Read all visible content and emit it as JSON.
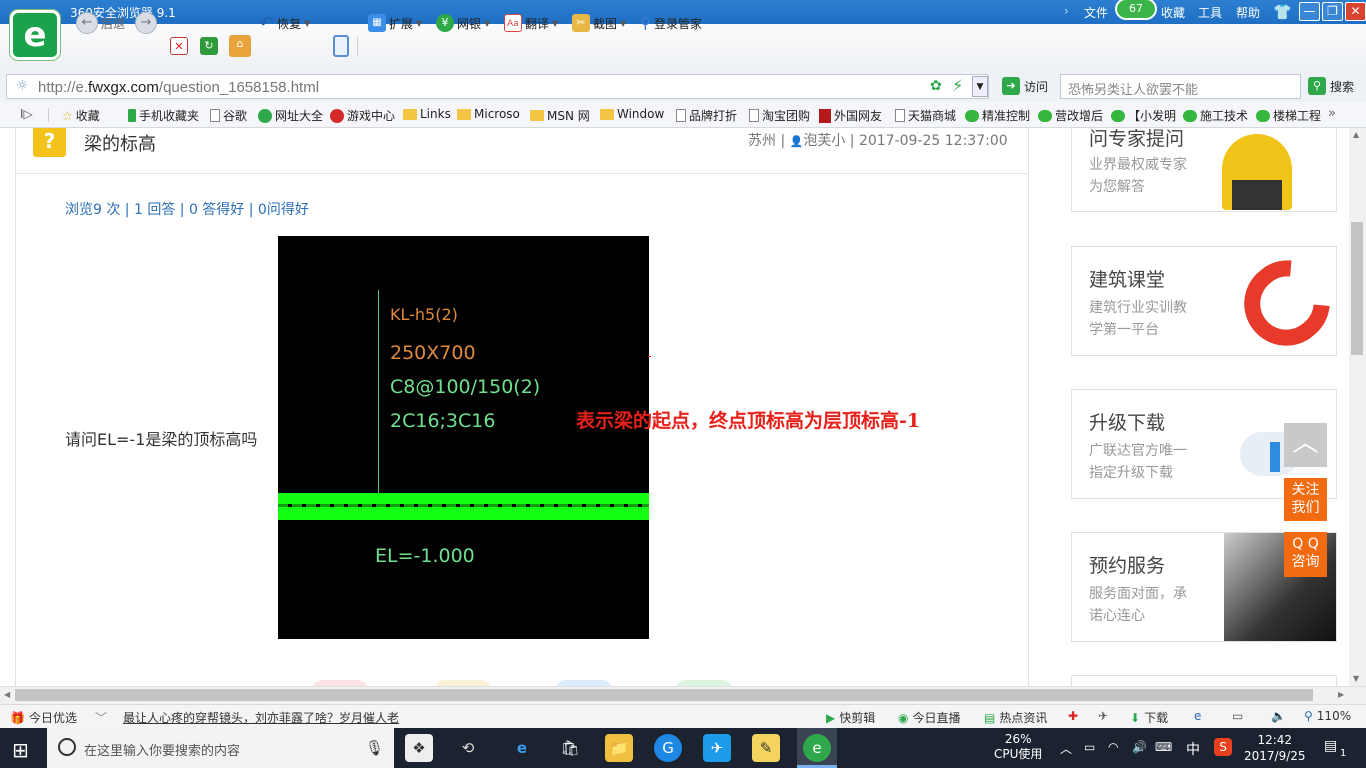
{
  "browser": {
    "title": "360安全浏览器 9.1",
    "logo_letter": "e",
    "menu": [
      "文件",
      "收藏",
      "工具",
      "帮助"
    ],
    "badge": "67",
    "window_buttons": [
      "—",
      "❐",
      "✕"
    ]
  },
  "toolbar": {
    "back": "后退",
    "restore": "恢复",
    "extend": "扩展",
    "bank": "网银",
    "translate": "翻译",
    "screenshot": "截图",
    "login": "登录管家"
  },
  "address": {
    "url_prefix": "http://e.",
    "url_domain": "fwxgx.com",
    "url_path": "/question_1658158.html",
    "visit": "访问",
    "search_placeholder": "恐怖另类让人欲罢不能",
    "search_button": "搜索"
  },
  "bookmarks": [
    "收藏",
    "手机收藏夹",
    "谷歌",
    "网址大全",
    "游戏中心",
    "Links",
    "Microso",
    "MSN 网",
    "Window",
    "品牌打折",
    "淘宝团购",
    "外国网友",
    "天猫商城",
    "精准控制",
    "营改增后",
    "【小发明",
    "施工技术",
    "楼梯工程"
  ],
  "question": {
    "icon": "?",
    "title": "梁的标高",
    "meta": "苏州 | ",
    "author": "泡芙小",
    "date": " | 2017-09-25 12:37:00",
    "stats": "浏览9 次 | 1 回答 | 0 答得好 | 0问得好",
    "text": "请问EL=-1是梁的顶标高吗"
  },
  "cad": {
    "beam": "KL-h5(2)",
    "size": "250X700",
    "stirrup": "C8@100/150(2)",
    "rebar": "2C16;3C16",
    "elevation": "EL=-1.000",
    "annotation": "表示梁的起点，终点顶标高为层顶标高-1"
  },
  "sidebar": [
    {
      "title": "问专家提问",
      "sub1": "业界最权威专家",
      "sub2": "为您解答"
    },
    {
      "title": "建筑课堂",
      "sub1": "建筑行业实训教",
      "sub2": "学第一平台"
    },
    {
      "title": "升级下载",
      "sub1": "广联达官方唯一",
      "sub2": "指定升级下载"
    },
    {
      "title": "预约服务",
      "sub1": "服务面对面，承",
      "sub2": "诺心连心"
    }
  ],
  "float": {
    "top": "︿",
    "follow1": "关注",
    "follow2": "我们",
    "qq1": "Q Q",
    "qq2": "咨询"
  },
  "status": {
    "today": "今日优选",
    "headline": "最让人心疼的穿帮镜头，刘亦菲露了啥？岁月催人老",
    "clip": "快剪辑",
    "live": "今日直播",
    "news": "热点资讯",
    "download": "下载",
    "zoom": "110%"
  },
  "taskbar": {
    "search_placeholder": "在这里输入你要搜索的内容",
    "cpu": "26%",
    "cpu_label": "CPU使用",
    "ime": "中",
    "time": "12:42",
    "date": "2017/9/25",
    "notify": "1"
  }
}
